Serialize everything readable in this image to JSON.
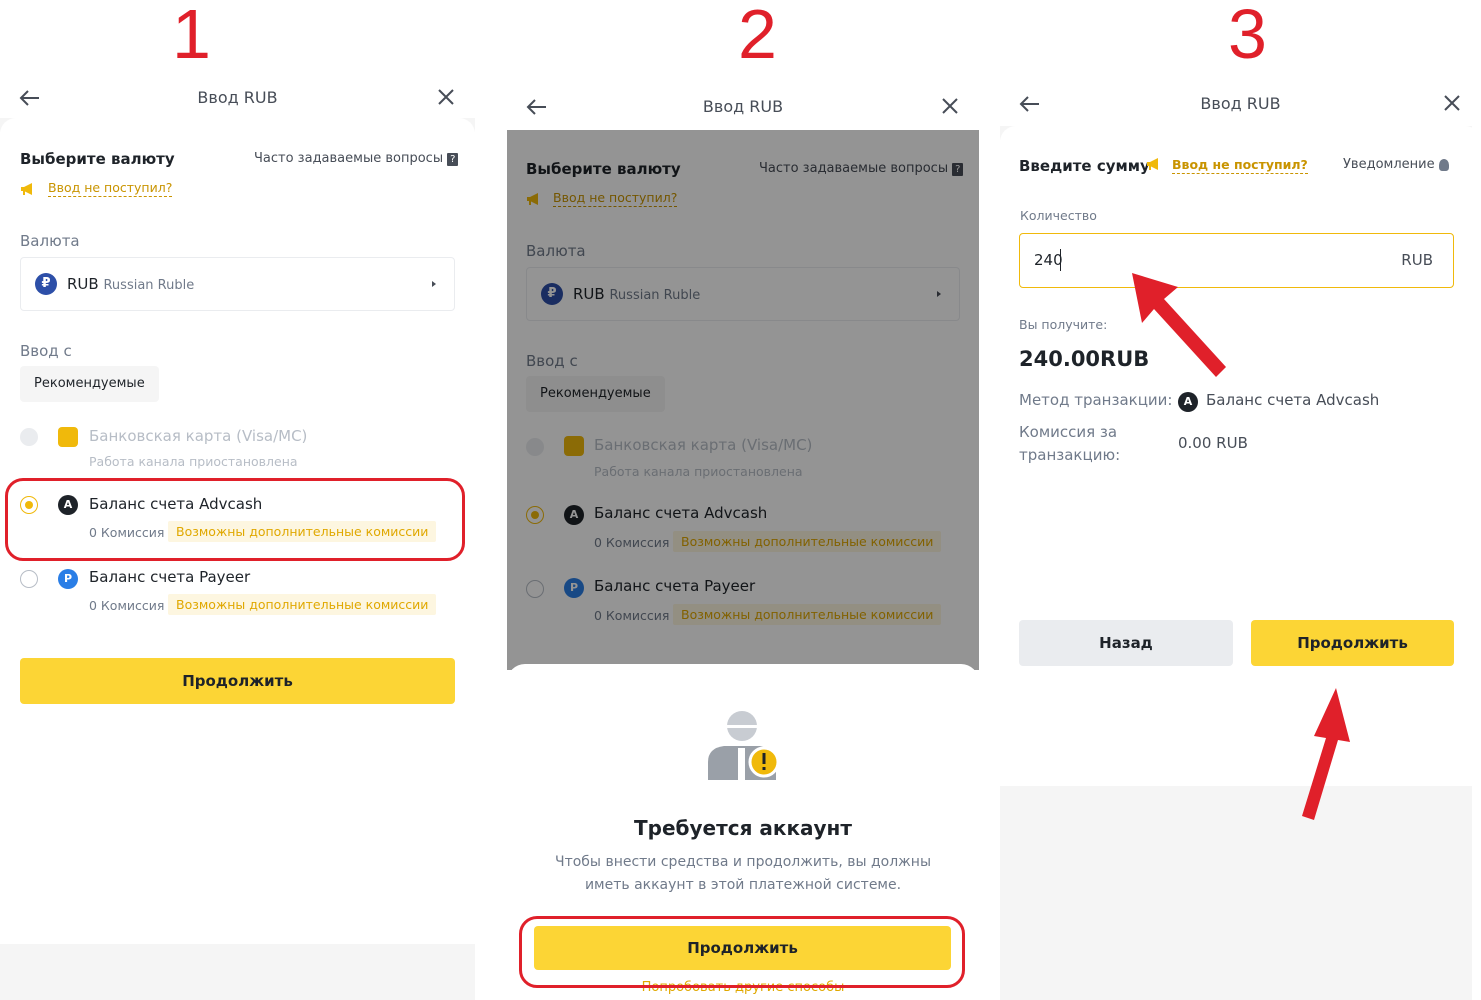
{
  "steps": [
    "1",
    "2",
    "3"
  ],
  "screen1": {
    "header_title": "Ввод RUB",
    "select_currency": "Выберите валюту",
    "faq": "Часто задаваемые вопросы",
    "not_received": "Ввод не поступил?",
    "currency_label": "Валюта",
    "currency_code": "RUB",
    "currency_name": "Russian Ruble",
    "deposit_from": "Ввод с",
    "recommended": "Рекомендуемые",
    "methods": [
      {
        "name": "Банковская карта (Visa/MC)",
        "sub": "Работа канала приостановлена",
        "state": "disabled",
        "icon": "card-icon"
      },
      {
        "name": "Баланс счета Advcash",
        "commission": "0 Комиссия",
        "tag": "Возможны дополнительные комиссии",
        "state": "selected",
        "icon": "advcash-icon"
      },
      {
        "name": "Баланс счета Payeer",
        "commission": "0 Комиссия",
        "tag": "Возможны дополнительные комиссии",
        "state": "unselected",
        "icon": "payeer-icon"
      }
    ],
    "continue": "Продолжить"
  },
  "screen2": {
    "header_title": "Ввод RUB",
    "select_currency": "Выберите валюту",
    "faq": "Часто задаваемые вопросы",
    "not_received": "Ввод не поступил?",
    "currency_label": "Валюта",
    "currency_code": "RUB",
    "currency_name": "Russian Ruble",
    "deposit_from": "Ввод с",
    "recommended": "Рекомендуемые",
    "methods": [
      {
        "name": "Банковская карта (Visa/MC)",
        "sub": "Работа канала приостановлена"
      },
      {
        "name": "Баланс счета Advcash",
        "commission": "0 Комиссия",
        "tag": "Возможны дополнительные комиссии"
      },
      {
        "name": "Баланс счета Payeer",
        "commission": "0 Комиссия",
        "tag": "Возможны дополнительные комиссии"
      }
    ],
    "modal": {
      "title": "Требуется аккаунт",
      "text_line1": "Чтобы внести средства и продолжить, вы должны",
      "text_line2": "иметь аккаунт в этой платежной системе.",
      "continue": "Продолжить",
      "other_methods": "Попробовать другие способы"
    }
  },
  "screen3": {
    "header_title": "Ввод RUB",
    "enter_amount": "Введите сумму",
    "not_received": "Ввод не поступил?",
    "notification": "Уведомление",
    "quantity_label": "Количество",
    "quantity_value": "240",
    "quantity_unit": "RUB",
    "you_get_label": "Вы получите:",
    "you_get_value": "240.00RUB",
    "method_label": "Метод транзакции:",
    "method_value": "Баланс счета Advcash",
    "fee_label_line1": "Комиссия за",
    "fee_label_line2": "транзакцию:",
    "fee_value": "0.00 RUB",
    "back": "Назад",
    "continue": "Продолжить"
  },
  "colors": {
    "accent": "#fcd535",
    "annotation": "#e0202a",
    "brand_gold": "#f0b90b"
  }
}
